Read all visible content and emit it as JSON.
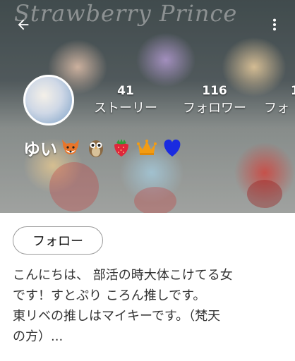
{
  "header": {
    "board_text": "Strawberry Prince",
    "back_icon": "arrow-left-icon",
    "menu_icon": "more-vert-icon"
  },
  "profile": {
    "name": "ゆい",
    "emoji_icons": [
      "fox-icon",
      "owl-icon",
      "strawberry-icon",
      "crown-icon",
      "blue-heart-icon"
    ],
    "stats": [
      {
        "count": "41",
        "label": "ストーリー"
      },
      {
        "count": "116",
        "label": "フォロワー"
      },
      {
        "count": "1",
        "label": "フォ"
      }
    ]
  },
  "follow_button": {
    "label": "フォロー"
  },
  "bio": {
    "lines": [
      "こんにちは、 部活の時大体こけてる女",
      "です！すとぷり ころん推しです。",
      "東リベの推しはマイキーです。（梵天",
      "の方）..."
    ]
  },
  "colors": {
    "blue_heart": "#1a2be0",
    "crown": "#f39c12",
    "strawberry": "#e0263a",
    "fox": "#e8752a"
  }
}
